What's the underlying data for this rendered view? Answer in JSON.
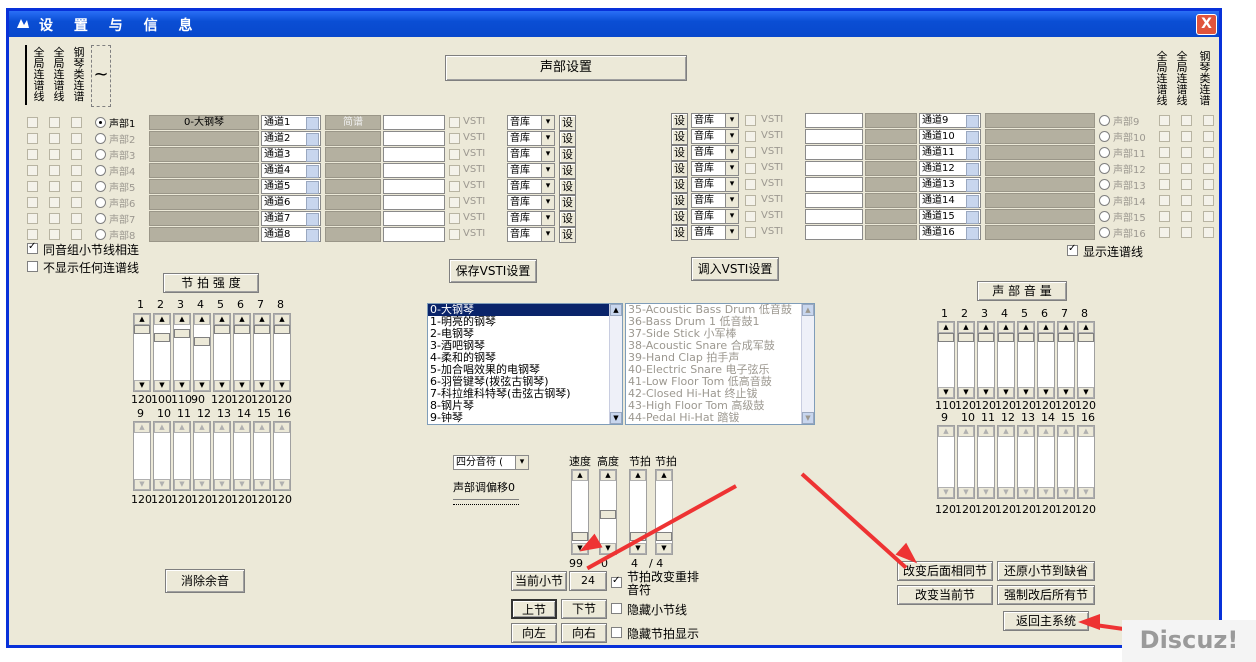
{
  "window": {
    "title": "设 置 与 信 息",
    "close": "X"
  },
  "top_left_vert": [
    "全局连谱线",
    "全局连谱线",
    "钢琴类连谱"
  ],
  "top_right_vert": [
    "全局连谱线",
    "全局连谱线",
    "钢琴类连谱"
  ],
  "part_setup_button": "声部设置",
  "left_parts": [
    {
      "label": "声部1",
      "instrument": "0-大钢琴",
      "channel": "通道1",
      "notation": "简谱",
      "selected": true,
      "active": true
    },
    {
      "label": "声部2",
      "instrument": "",
      "channel": "通道2",
      "notation": "",
      "active": false
    },
    {
      "label": "声部3",
      "instrument": "",
      "channel": "通道3",
      "notation": "",
      "active": false
    },
    {
      "label": "声部4",
      "instrument": "",
      "channel": "通道4",
      "notation": "",
      "active": false
    },
    {
      "label": "声部5",
      "instrument": "",
      "channel": "通道5",
      "notation": "",
      "active": false
    },
    {
      "label": "声部6",
      "instrument": "",
      "channel": "通道6",
      "notation": "",
      "active": false
    },
    {
      "label": "声部7",
      "instrument": "",
      "channel": "通道7",
      "notation": "",
      "active": false
    },
    {
      "label": "声部8",
      "instrument": "",
      "channel": "通道8",
      "notation": "",
      "active": false
    }
  ],
  "right_parts": [
    {
      "label": "声部9",
      "channel": "通道9"
    },
    {
      "label": "声部10",
      "channel": "通道10"
    },
    {
      "label": "声部11",
      "channel": "通道11"
    },
    {
      "label": "声部12",
      "channel": "通道12"
    },
    {
      "label": "声部13",
      "channel": "通道13"
    },
    {
      "label": "声部14",
      "channel": "通道14"
    },
    {
      "label": "声部15",
      "channel": "通道15"
    },
    {
      "label": "声部16",
      "channel": "通道16"
    }
  ],
  "vsti_label": "VSTI",
  "lib_label": "音库",
  "set_label": "设",
  "same_pitch_link": "同音组小节线相连",
  "no_links": "不显示任何连谱线",
  "show_links": "显示连谱线",
  "save_vsti": "保存VSTI设置",
  "load_vsti": "调入VSTI设置",
  "beat_strength": {
    "title": "节 拍 强 度",
    "nums_top": [
      "1",
      "2",
      "3",
      "4",
      "5",
      "6",
      "7",
      "8"
    ],
    "vals_top": [
      "120",
      "100",
      "110",
      "90",
      "120",
      "120",
      "120",
      "120"
    ],
    "levels_top": [
      1,
      0.833,
      0.917,
      0.75,
      1,
      1,
      1,
      1
    ],
    "nums_bot": [
      "9",
      "10",
      "11",
      "12",
      "13",
      "14",
      "15",
      "16"
    ],
    "vals_bot": [
      "120",
      "120",
      "120",
      "120",
      "120",
      "120",
      "120",
      "120"
    ]
  },
  "part_volume": {
    "title": "声 部 音 量",
    "nums_top": [
      "1",
      "2",
      "3",
      "4",
      "5",
      "6",
      "7",
      "8"
    ],
    "vals_top": [
      "110",
      "120",
      "120",
      "120",
      "120",
      "120",
      "120",
      "120"
    ],
    "nums_bot": [
      "9",
      "10",
      "11",
      "12",
      "13",
      "14",
      "15",
      "16"
    ],
    "vals_bot": [
      "120",
      "120",
      "120",
      "120",
      "120",
      "120",
      "120",
      "120"
    ]
  },
  "instruments": [
    "0-大钢琴",
    "1-明亮的钢琴",
    "2-电钢琴",
    "3-酒吧钢琴",
    "4-柔和的钢琴",
    "5-加合唱效果的电钢琴",
    "6-羽管键琴(拨弦古钢琴)",
    "7-科拉维科特琴(击弦古钢琴)",
    "8-钢片琴",
    "9-钟琴"
  ],
  "drums": [
    "35-Acoustic Bass Drum  低音鼓",
    "36-Bass Drum 1 低音鼓1",
    "37-Side Stick 小军棒",
    "38-Acoustic Snare 合成军鼓",
    "39-Hand Clap 拍手声",
    "40-Electric Snare 电子弦乐",
    "41-Low Floor Tom 低高音鼓",
    "42-Closed Hi-Hat 终止钹",
    "43-High Floor Tom 高级鼓",
    "44-Pedal Hi-Hat 踏钹"
  ],
  "note_combo": "四分音符 (",
  "offset_label": "声部调偏移0",
  "tempo": {
    "labels": [
      "速度",
      "高度",
      "节拍",
      "节拍"
    ],
    "speed": "99",
    "height": "0",
    "beat_num": "4",
    "beat_den": "/ 4"
  },
  "eliminate": "消除余音",
  "current_bar_btn": "当前小节",
  "current_bar_val": "24",
  "reorder_check": "节拍改变重排音符",
  "prev_bar": "上节",
  "next_bar": "下节",
  "hide_bar": "隐藏小节线",
  "left": "向左",
  "right": "向右",
  "hide_beat": "隐藏节拍显示",
  "change_after": "改变后面相同节",
  "restore_default": "还原小节到缺省",
  "change_current": "改变当前节",
  "force_all": "强制改后所有节",
  "return_main": "返回主系统",
  "watermark": "Discuz!"
}
